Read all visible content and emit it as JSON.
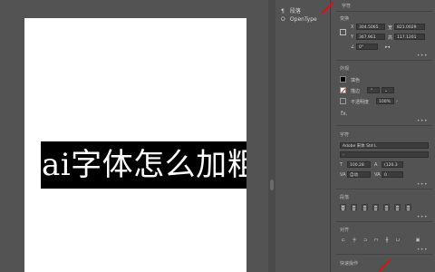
{
  "canvas": {
    "headline_text": "ai字体怎么加粗"
  },
  "libraries": {
    "items": [
      {
        "label": "段落",
        "icon": "paragraph-icon"
      },
      {
        "label": "OpenType",
        "icon": "opentype-icon"
      }
    ]
  },
  "properties": {
    "top_label": "字符",
    "transform": {
      "title": "变换",
      "x_label": "X",
      "x_value": "304.5065",
      "y_label": "Y",
      "y_value": "367.961",
      "w_label": "宽",
      "w_value": "821.0029",
      "h_label": "高",
      "h_value": "117.1201",
      "angle_label": "∠",
      "angle_value": "0°"
    },
    "appearance": {
      "title": "外观",
      "fill_label": "填色",
      "stroke_label": "描边",
      "opacity_label": "不透明度",
      "opacity_value": "100%",
      "fx_label": "fx."
    },
    "character": {
      "title": "字符",
      "font_value": "Adobe 宋体 Std L",
      "style_value": "-",
      "size_value": "100.28",
      "leading_value": "(120.3",
      "tracking_value": "自动",
      "kerning_value": "0"
    },
    "paragraph": {
      "title": "段落"
    },
    "align": {
      "title": "对齐"
    },
    "quick_actions": {
      "title": "快速操作"
    }
  }
}
